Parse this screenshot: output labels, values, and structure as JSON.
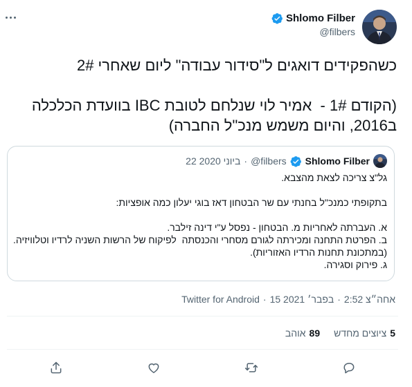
{
  "author": {
    "name": "Shlomo Filber",
    "handle": "@filbers"
  },
  "tweet": {
    "text": "כשהפקידים דואגים ל\"סידור עבודה\" ליום שאחרי 2#\n\n(הקודם 1# -  אמיר לוי שנלחם לטובת IBC בוועדת הכלכלה ב2016, והיום משמש מנכ\"ל החברה)"
  },
  "quote": {
    "name": "Shlomo Filber",
    "handle": "@filbers",
    "separator": "·",
    "date": "22 ביוני 2020",
    "text": "גל\"צ צריכה לצאת מהצבא.\n\nבתקופתי כמנכ\"ל בחנתי עם שר הבטחון דאז בוגי יעלון כמה אופציות:\n\nא. העברתה לאחריות מ. הבטחון - נפסל ע\"י דינה זילבר.\nב. הפרטת התחנה ומכירתה לגורם מסחרי והכנסתה  לפיקוח של הרשות השניה לרדיו וטלוויזיה. (במתכונת תחנות הרדיו האזוריות).\nג. פירוק וסגירה."
  },
  "meta": {
    "time": "2:52 אחה״צ",
    "separator": "·",
    "date": "15 בפבר׳ 2021",
    "source": "Twitter for Android"
  },
  "stats": {
    "retweets_count": "5",
    "retweets_label": "ציוצים מחדש",
    "likes_count": "89",
    "likes_label": "אוהב"
  },
  "icons": {
    "more": "more-horizontal-icon",
    "verified": "verified-badge-icon",
    "reply": "reply-icon",
    "retweet": "retweet-icon",
    "like": "heart-icon",
    "share": "share-icon"
  },
  "colors": {
    "verified_blue": "#1d9bf0",
    "text": "#0f1419",
    "secondary": "#536471",
    "border": "#cfd9de"
  }
}
